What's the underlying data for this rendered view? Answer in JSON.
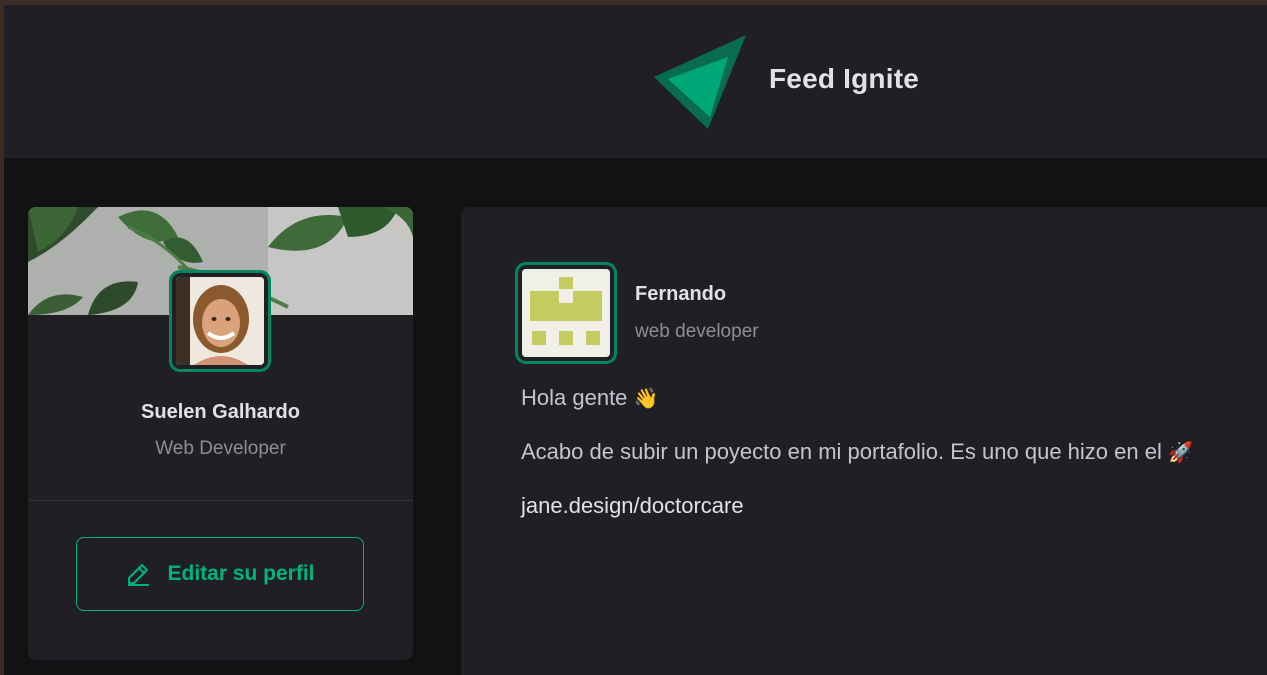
{
  "app": {
    "brand_title": "Feed Ignite",
    "logo_icon": "ignite-triangle-logo-icon",
    "accent_color": "#00875f",
    "accent_light": "#00b37e"
  },
  "sidebar": {
    "profile": {
      "name": "Suelen Galhardo",
      "role": "Web Developer",
      "avatar_icon": "user-photo-avatar"
    },
    "edit_button": {
      "label": "Editar su perfil",
      "icon": "pencil-icon"
    }
  },
  "post": {
    "author": {
      "name": "Fernando",
      "role": "web developer",
      "avatar_icon": "identicon-avatar"
    },
    "content": {
      "line1": "Hola gente",
      "line1_emoji": "👋",
      "line2": "Acabo de subir un poyecto en mi portafolio. Es uno que hizo en el",
      "line2_emoji": "🚀",
      "link": "jane.design/doctorcare"
    }
  }
}
